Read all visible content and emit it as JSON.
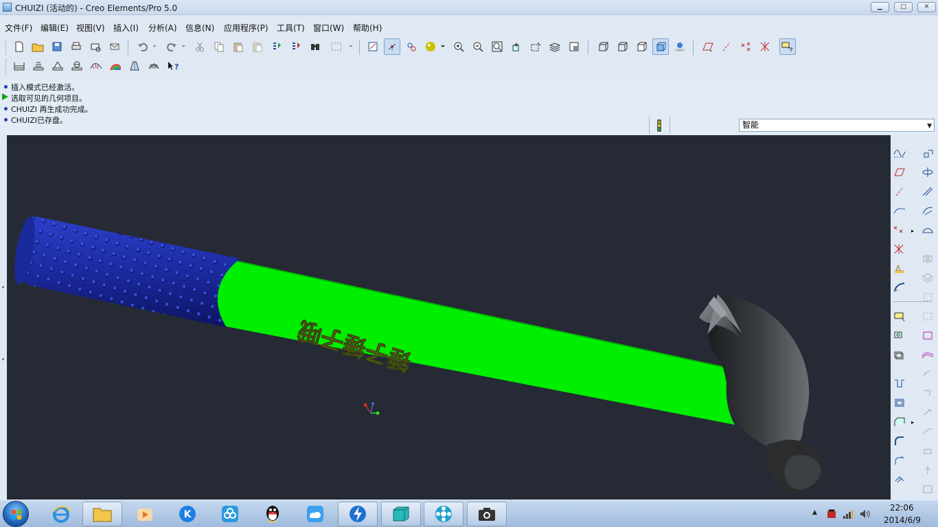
{
  "window": {
    "title": "CHUIZI (活动的) - Creo Elements/Pro 5.0",
    "minimize_icon": "minimize-icon",
    "maximize_icon": "maximize-icon",
    "close_icon": "close-icon"
  },
  "menu": {
    "items": [
      "文件(F)",
      "编辑(E)",
      "视图(V)",
      "插入(I)",
      "分析(A)",
      "信息(N)",
      "应用程序(P)",
      "工具(T)",
      "窗口(W)",
      "帮助(H)"
    ]
  },
  "messages": {
    "lines": [
      "插入模式已经激活。",
      "选取可见的几何项目。",
      "CHUIZI 再生成功完成。",
      "CHUIZI已存盘。"
    ]
  },
  "filter": {
    "selected": "智能"
  },
  "model": {
    "engraved_text": "锤子锤子哦",
    "handle_color": "#00ee00",
    "grip_color": "#1a2aa0",
    "head_color": "#2e3032"
  },
  "clock": {
    "time": "22:06",
    "date": "2014/6/9"
  },
  "colors": {
    "viewport_bg": "#252a35",
    "chrome_bg": "#dfe8f3"
  }
}
